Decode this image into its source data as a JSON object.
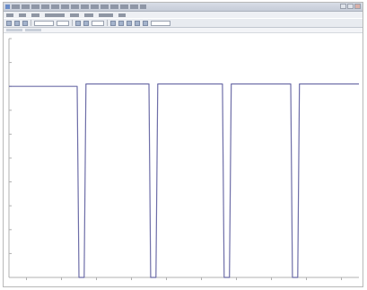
{
  "window": {
    "title": "",
    "controls": [
      "minimize",
      "maximize",
      "close"
    ]
  },
  "menu": {
    "items": [
      "",
      "",
      "",
      "",
      "",
      "",
      "",
      ""
    ]
  },
  "toolbar": {
    "buttons": [
      "open-icon",
      "save-icon",
      "print-icon",
      "zoom-in-icon",
      "zoom-out-icon",
      "cursor-icon",
      "measure-icon",
      "settings-icon"
    ]
  },
  "colors": {
    "trace": "#6e6ea8",
    "axis": "#b0b0b0",
    "background": "#ffffff"
  },
  "chart_data": {
    "type": "line",
    "title": "",
    "xlabel": "",
    "ylabel": "",
    "grid": false,
    "ylim": [
      0,
      10
    ],
    "xlim": [
      0,
      10
    ],
    "series": [
      {
        "name": "",
        "x": [
          0,
          1.95,
          2.0,
          2.15,
          2.2,
          4.0,
          4.05,
          4.2,
          4.25,
          6.1,
          6.15,
          6.3,
          6.35,
          8.05,
          8.1,
          8.25,
          8.3,
          10
        ],
        "y": [
          8,
          8,
          0,
          0,
          8.1,
          8.1,
          0,
          0,
          8.1,
          8.1,
          0,
          0,
          8.1,
          8.1,
          0,
          0,
          8.1,
          8.1
        ]
      }
    ],
    "x_ticks": [
      "",
      "",
      "",
      "",
      "",
      "",
      "",
      "",
      "",
      ""
    ],
    "y_ticks": [
      "",
      "",
      "",
      "",
      "",
      "",
      "",
      "",
      "",
      ""
    ]
  }
}
